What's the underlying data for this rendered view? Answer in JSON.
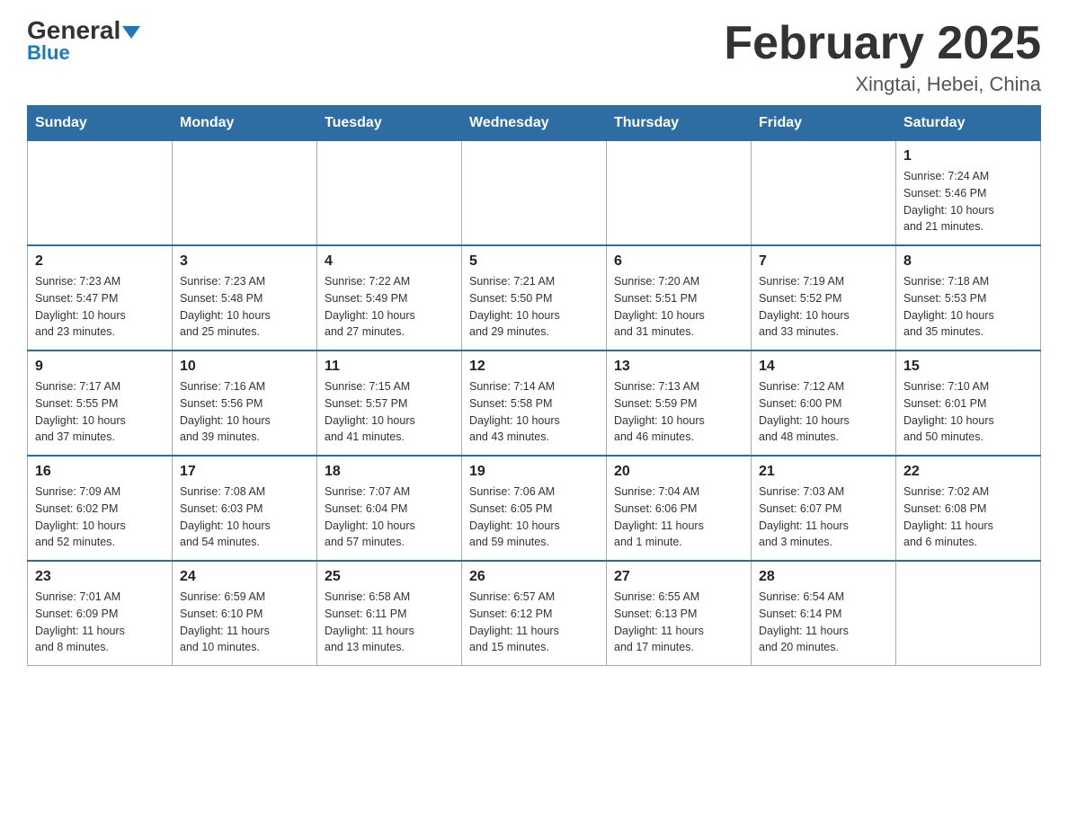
{
  "header": {
    "logo_main": "General",
    "logo_sub": "Blue",
    "month_title": "February 2025",
    "location": "Xingtai, Hebei, China"
  },
  "weekdays": [
    "Sunday",
    "Monday",
    "Tuesday",
    "Wednesday",
    "Thursday",
    "Friday",
    "Saturday"
  ],
  "weeks": [
    [
      {
        "day": "",
        "info": ""
      },
      {
        "day": "",
        "info": ""
      },
      {
        "day": "",
        "info": ""
      },
      {
        "day": "",
        "info": ""
      },
      {
        "day": "",
        "info": ""
      },
      {
        "day": "",
        "info": ""
      },
      {
        "day": "1",
        "info": "Sunrise: 7:24 AM\nSunset: 5:46 PM\nDaylight: 10 hours\nand 21 minutes."
      }
    ],
    [
      {
        "day": "2",
        "info": "Sunrise: 7:23 AM\nSunset: 5:47 PM\nDaylight: 10 hours\nand 23 minutes."
      },
      {
        "day": "3",
        "info": "Sunrise: 7:23 AM\nSunset: 5:48 PM\nDaylight: 10 hours\nand 25 minutes."
      },
      {
        "day": "4",
        "info": "Sunrise: 7:22 AM\nSunset: 5:49 PM\nDaylight: 10 hours\nand 27 minutes."
      },
      {
        "day": "5",
        "info": "Sunrise: 7:21 AM\nSunset: 5:50 PM\nDaylight: 10 hours\nand 29 minutes."
      },
      {
        "day": "6",
        "info": "Sunrise: 7:20 AM\nSunset: 5:51 PM\nDaylight: 10 hours\nand 31 minutes."
      },
      {
        "day": "7",
        "info": "Sunrise: 7:19 AM\nSunset: 5:52 PM\nDaylight: 10 hours\nand 33 minutes."
      },
      {
        "day": "8",
        "info": "Sunrise: 7:18 AM\nSunset: 5:53 PM\nDaylight: 10 hours\nand 35 minutes."
      }
    ],
    [
      {
        "day": "9",
        "info": "Sunrise: 7:17 AM\nSunset: 5:55 PM\nDaylight: 10 hours\nand 37 minutes."
      },
      {
        "day": "10",
        "info": "Sunrise: 7:16 AM\nSunset: 5:56 PM\nDaylight: 10 hours\nand 39 minutes."
      },
      {
        "day": "11",
        "info": "Sunrise: 7:15 AM\nSunset: 5:57 PM\nDaylight: 10 hours\nand 41 minutes."
      },
      {
        "day": "12",
        "info": "Sunrise: 7:14 AM\nSunset: 5:58 PM\nDaylight: 10 hours\nand 43 minutes."
      },
      {
        "day": "13",
        "info": "Sunrise: 7:13 AM\nSunset: 5:59 PM\nDaylight: 10 hours\nand 46 minutes."
      },
      {
        "day": "14",
        "info": "Sunrise: 7:12 AM\nSunset: 6:00 PM\nDaylight: 10 hours\nand 48 minutes."
      },
      {
        "day": "15",
        "info": "Sunrise: 7:10 AM\nSunset: 6:01 PM\nDaylight: 10 hours\nand 50 minutes."
      }
    ],
    [
      {
        "day": "16",
        "info": "Sunrise: 7:09 AM\nSunset: 6:02 PM\nDaylight: 10 hours\nand 52 minutes."
      },
      {
        "day": "17",
        "info": "Sunrise: 7:08 AM\nSunset: 6:03 PM\nDaylight: 10 hours\nand 54 minutes."
      },
      {
        "day": "18",
        "info": "Sunrise: 7:07 AM\nSunset: 6:04 PM\nDaylight: 10 hours\nand 57 minutes."
      },
      {
        "day": "19",
        "info": "Sunrise: 7:06 AM\nSunset: 6:05 PM\nDaylight: 10 hours\nand 59 minutes."
      },
      {
        "day": "20",
        "info": "Sunrise: 7:04 AM\nSunset: 6:06 PM\nDaylight: 11 hours\nand 1 minute."
      },
      {
        "day": "21",
        "info": "Sunrise: 7:03 AM\nSunset: 6:07 PM\nDaylight: 11 hours\nand 3 minutes."
      },
      {
        "day": "22",
        "info": "Sunrise: 7:02 AM\nSunset: 6:08 PM\nDaylight: 11 hours\nand 6 minutes."
      }
    ],
    [
      {
        "day": "23",
        "info": "Sunrise: 7:01 AM\nSunset: 6:09 PM\nDaylight: 11 hours\nand 8 minutes."
      },
      {
        "day": "24",
        "info": "Sunrise: 6:59 AM\nSunset: 6:10 PM\nDaylight: 11 hours\nand 10 minutes."
      },
      {
        "day": "25",
        "info": "Sunrise: 6:58 AM\nSunset: 6:11 PM\nDaylight: 11 hours\nand 13 minutes."
      },
      {
        "day": "26",
        "info": "Sunrise: 6:57 AM\nSunset: 6:12 PM\nDaylight: 11 hours\nand 15 minutes."
      },
      {
        "day": "27",
        "info": "Sunrise: 6:55 AM\nSunset: 6:13 PM\nDaylight: 11 hours\nand 17 minutes."
      },
      {
        "day": "28",
        "info": "Sunrise: 6:54 AM\nSunset: 6:14 PM\nDaylight: 11 hours\nand 20 minutes."
      },
      {
        "day": "",
        "info": ""
      }
    ]
  ]
}
